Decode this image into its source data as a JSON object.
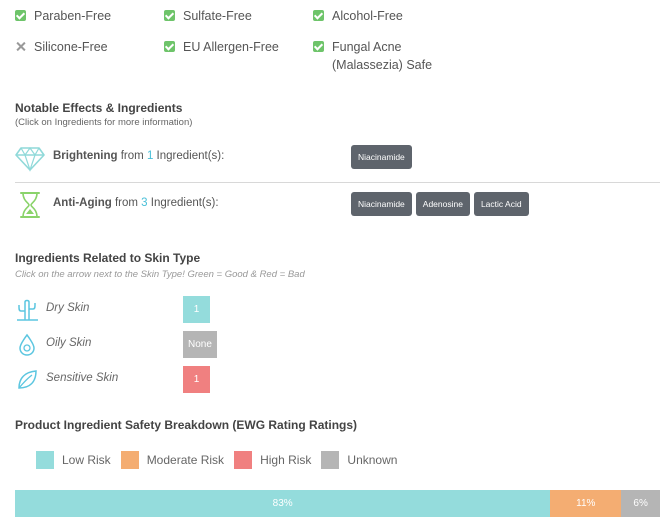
{
  "free_from": [
    {
      "label": "Paraben-Free",
      "ok": true
    },
    {
      "label": "Sulfate-Free",
      "ok": true
    },
    {
      "label": "Alcohol-Free",
      "ok": true
    },
    {
      "label": "Silicone-Free",
      "ok": false
    },
    {
      "label": "EU Allergen-Free",
      "ok": true
    },
    {
      "label": "Fungal Acne\n(Malassezia) Safe",
      "ok": true
    }
  ],
  "effects": {
    "title": "Notable Effects & Ingredients",
    "subtitle": "(Click on Ingredients for more information)",
    "from_word": "from",
    "count_suffix": "Ingredient(s):",
    "items": [
      {
        "name": "Brightening",
        "count": "1",
        "icon": "diamond-icon",
        "color": "#8fd9d9",
        "ingredients": [
          "Niacinamide"
        ]
      },
      {
        "name": "Anti-Aging",
        "count": "3",
        "icon": "hourglass-icon",
        "color": "#8ad36a",
        "ingredients": [
          "Niacinamide",
          "Adenosine",
          "Lactic Acid"
        ]
      }
    ]
  },
  "skin": {
    "title": "Ingredients Related to Skin Type",
    "subtitle": "Click on the arrow next to the Skin Type! Green = Good & Red = Bad",
    "items": [
      {
        "label": "Dry Skin",
        "value": "1",
        "icon": "cactus-icon",
        "color": "#94dcdc"
      },
      {
        "label": "Oily Skin",
        "value": "None",
        "icon": "droplet-icon",
        "color": "#b5b5b5"
      },
      {
        "label": "Sensitive Skin",
        "value": "1",
        "icon": "leaf-icon",
        "color": "#f08080"
      }
    ]
  },
  "safety": {
    "title": "Product Ingredient Safety Breakdown (EWG Rating Ratings)",
    "legend": [
      {
        "label": "Low Risk",
        "color": "#94dcdc"
      },
      {
        "label": "Moderate Risk",
        "color": "#f4ad72"
      },
      {
        "label": "High Risk",
        "color": "#f08080"
      },
      {
        "label": "Unknown",
        "color": "#b5b5b5"
      }
    ],
    "breakdown": [
      {
        "label": "83%",
        "value": 83,
        "color": "#94dcdc"
      },
      {
        "label": "11%",
        "value": 11,
        "color": "#f4ad72"
      },
      {
        "label": "6%",
        "value": 6,
        "color": "#b5b5b5"
      }
    ]
  }
}
